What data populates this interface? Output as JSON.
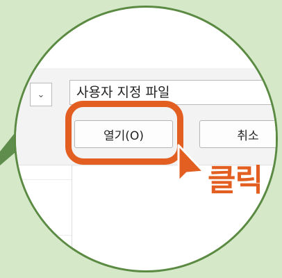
{
  "dialog": {
    "filetype_value": "사용자 지정 파일",
    "open_button_label": "열기(O)",
    "cancel_button_label": "취소",
    "dropdown_icon": "chevron-down-icon"
  },
  "annotation": {
    "callout_text": "클릭",
    "accent_color": "#e35f21",
    "pointer_icon": "cursor-arrow-icon"
  },
  "colors": {
    "background": "#d5e8c8",
    "lens_border": "#5b8a43",
    "wedge": "#5f8d4b"
  }
}
